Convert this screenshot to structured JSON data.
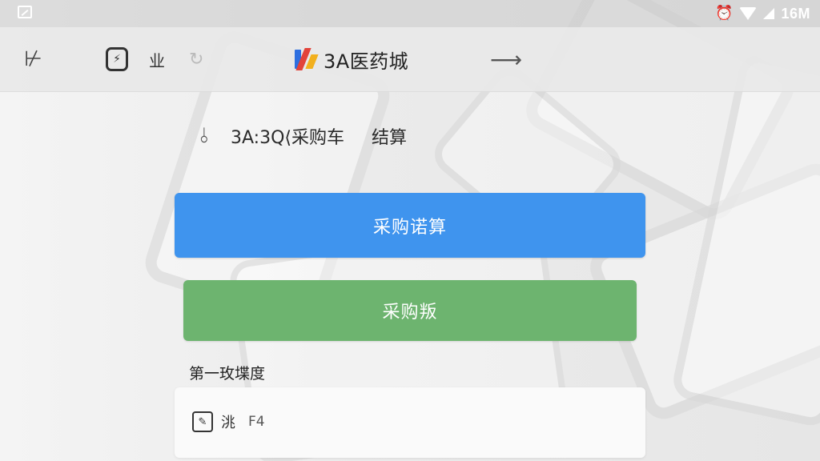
{
  "status_bar": {
    "battery_text": "16M"
  },
  "toolbar": {
    "tool_label": "业",
    "title": "3A医药城"
  },
  "cart": {
    "header_text": "3A:3Q⟨采购车",
    "checkout_label": "结算"
  },
  "buttons": {
    "primary_label": "采购诺算",
    "secondary_label": "采购叛"
  },
  "section": {
    "title": "第一玫堞度"
  },
  "card": {
    "item_text": "洮",
    "item_code": "F4"
  },
  "icons": {
    "status_left": "image-icon",
    "status_alarm": "alarm-icon",
    "wifi": "wifi-icon",
    "signal": "signal-icon",
    "back": "back-icon",
    "tool": "tool-icon",
    "refresh": "refresh-icon",
    "brand": "brand-logo",
    "forward": "forward-arrow-icon",
    "cart": "anchor-icon",
    "card_item": "edit-icon"
  },
  "colors": {
    "primary_button": "#3f94ee",
    "secondary_button": "#6db46f",
    "brand_blue": "#2e6fe0",
    "brand_red": "#e2433a",
    "brand_yellow": "#f2b01e"
  }
}
